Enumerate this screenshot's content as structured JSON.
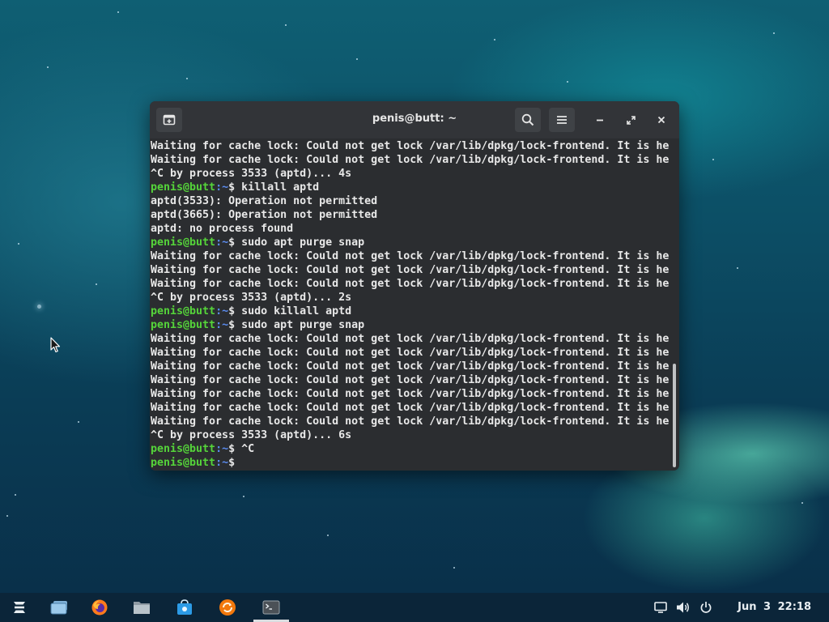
{
  "window": {
    "title": "penis@butt: ~",
    "new_tab_icon": "new-tab-icon",
    "search_icon": "search-icon",
    "menu_icon": "hamburger-menu-icon",
    "minimize_icon": "minimize-icon",
    "maximize_icon": "maximize-icon",
    "close_icon": "close-icon"
  },
  "terminal": {
    "prompt_user": "penis@butt",
    "prompt_path": ":~",
    "lines": [
      {
        "type": "out",
        "text": "Waiting for cache lock: Could not get lock /var/lib/dpkg/lock-frontend. It is he"
      },
      {
        "type": "out",
        "text": "Waiting for cache lock: Could not get lock /var/lib/dpkg/lock-frontend. It is he"
      },
      {
        "type": "out",
        "text": "^C by process 3533 (aptd)... 4s"
      },
      {
        "type": "cmd",
        "text": "$ killall aptd"
      },
      {
        "type": "out",
        "text": "aptd(3533): Operation not permitted"
      },
      {
        "type": "out",
        "text": "aptd(3665): Operation not permitted"
      },
      {
        "type": "out",
        "text": "aptd: no process found"
      },
      {
        "type": "cmd",
        "text": "$ sudo apt purge snap"
      },
      {
        "type": "out",
        "text": "Waiting for cache lock: Could not get lock /var/lib/dpkg/lock-frontend. It is he"
      },
      {
        "type": "out",
        "text": "Waiting for cache lock: Could not get lock /var/lib/dpkg/lock-frontend. It is he"
      },
      {
        "type": "out",
        "text": "Waiting for cache lock: Could not get lock /var/lib/dpkg/lock-frontend. It is he"
      },
      {
        "type": "out",
        "text": "^C by process 3533 (aptd)... 2s"
      },
      {
        "type": "cmd",
        "text": "$ sudo killall aptd"
      },
      {
        "type": "cmd",
        "text": "$ sudo apt purge snap"
      },
      {
        "type": "out",
        "text": "Waiting for cache lock: Could not get lock /var/lib/dpkg/lock-frontend. It is he"
      },
      {
        "type": "out",
        "text": "Waiting for cache lock: Could not get lock /var/lib/dpkg/lock-frontend. It is he"
      },
      {
        "type": "out",
        "text": "Waiting for cache lock: Could not get lock /var/lib/dpkg/lock-frontend. It is he"
      },
      {
        "type": "out",
        "text": "Waiting for cache lock: Could not get lock /var/lib/dpkg/lock-frontend. It is he"
      },
      {
        "type": "out",
        "text": "Waiting for cache lock: Could not get lock /var/lib/dpkg/lock-frontend. It is he"
      },
      {
        "type": "out",
        "text": "Waiting for cache lock: Could not get lock /var/lib/dpkg/lock-frontend. It is he"
      },
      {
        "type": "out",
        "text": "Waiting for cache lock: Could not get lock /var/lib/dpkg/lock-frontend. It is he"
      },
      {
        "type": "out",
        "text": "^C by process 3533 (aptd)... 6s"
      },
      {
        "type": "cmd",
        "text": "$ ^C"
      },
      {
        "type": "cmd",
        "text": "$ "
      }
    ]
  },
  "taskbar": {
    "apps": [
      {
        "name": "zorin-menu",
        "icon": "zorin-logo-icon"
      },
      {
        "name": "workspaces",
        "icon": "workspaces-icon"
      },
      {
        "name": "firefox",
        "icon": "firefox-icon"
      },
      {
        "name": "files",
        "icon": "files-icon"
      },
      {
        "name": "software",
        "icon": "software-store-icon"
      },
      {
        "name": "software-updater",
        "icon": "software-updater-icon"
      },
      {
        "name": "terminal",
        "icon": "terminal-icon",
        "active": true
      }
    ],
    "tray": {
      "display_icon": "display-icon",
      "volume_icon": "volume-icon",
      "power_icon": "power-icon"
    },
    "date": "Jun 3",
    "time": "22:18"
  },
  "colors": {
    "prompt_user": "#55d43a",
    "prompt_path": "#5b8cf0",
    "terminal_bg": "#2b2d30",
    "titlebar_bg": "#323438"
  }
}
